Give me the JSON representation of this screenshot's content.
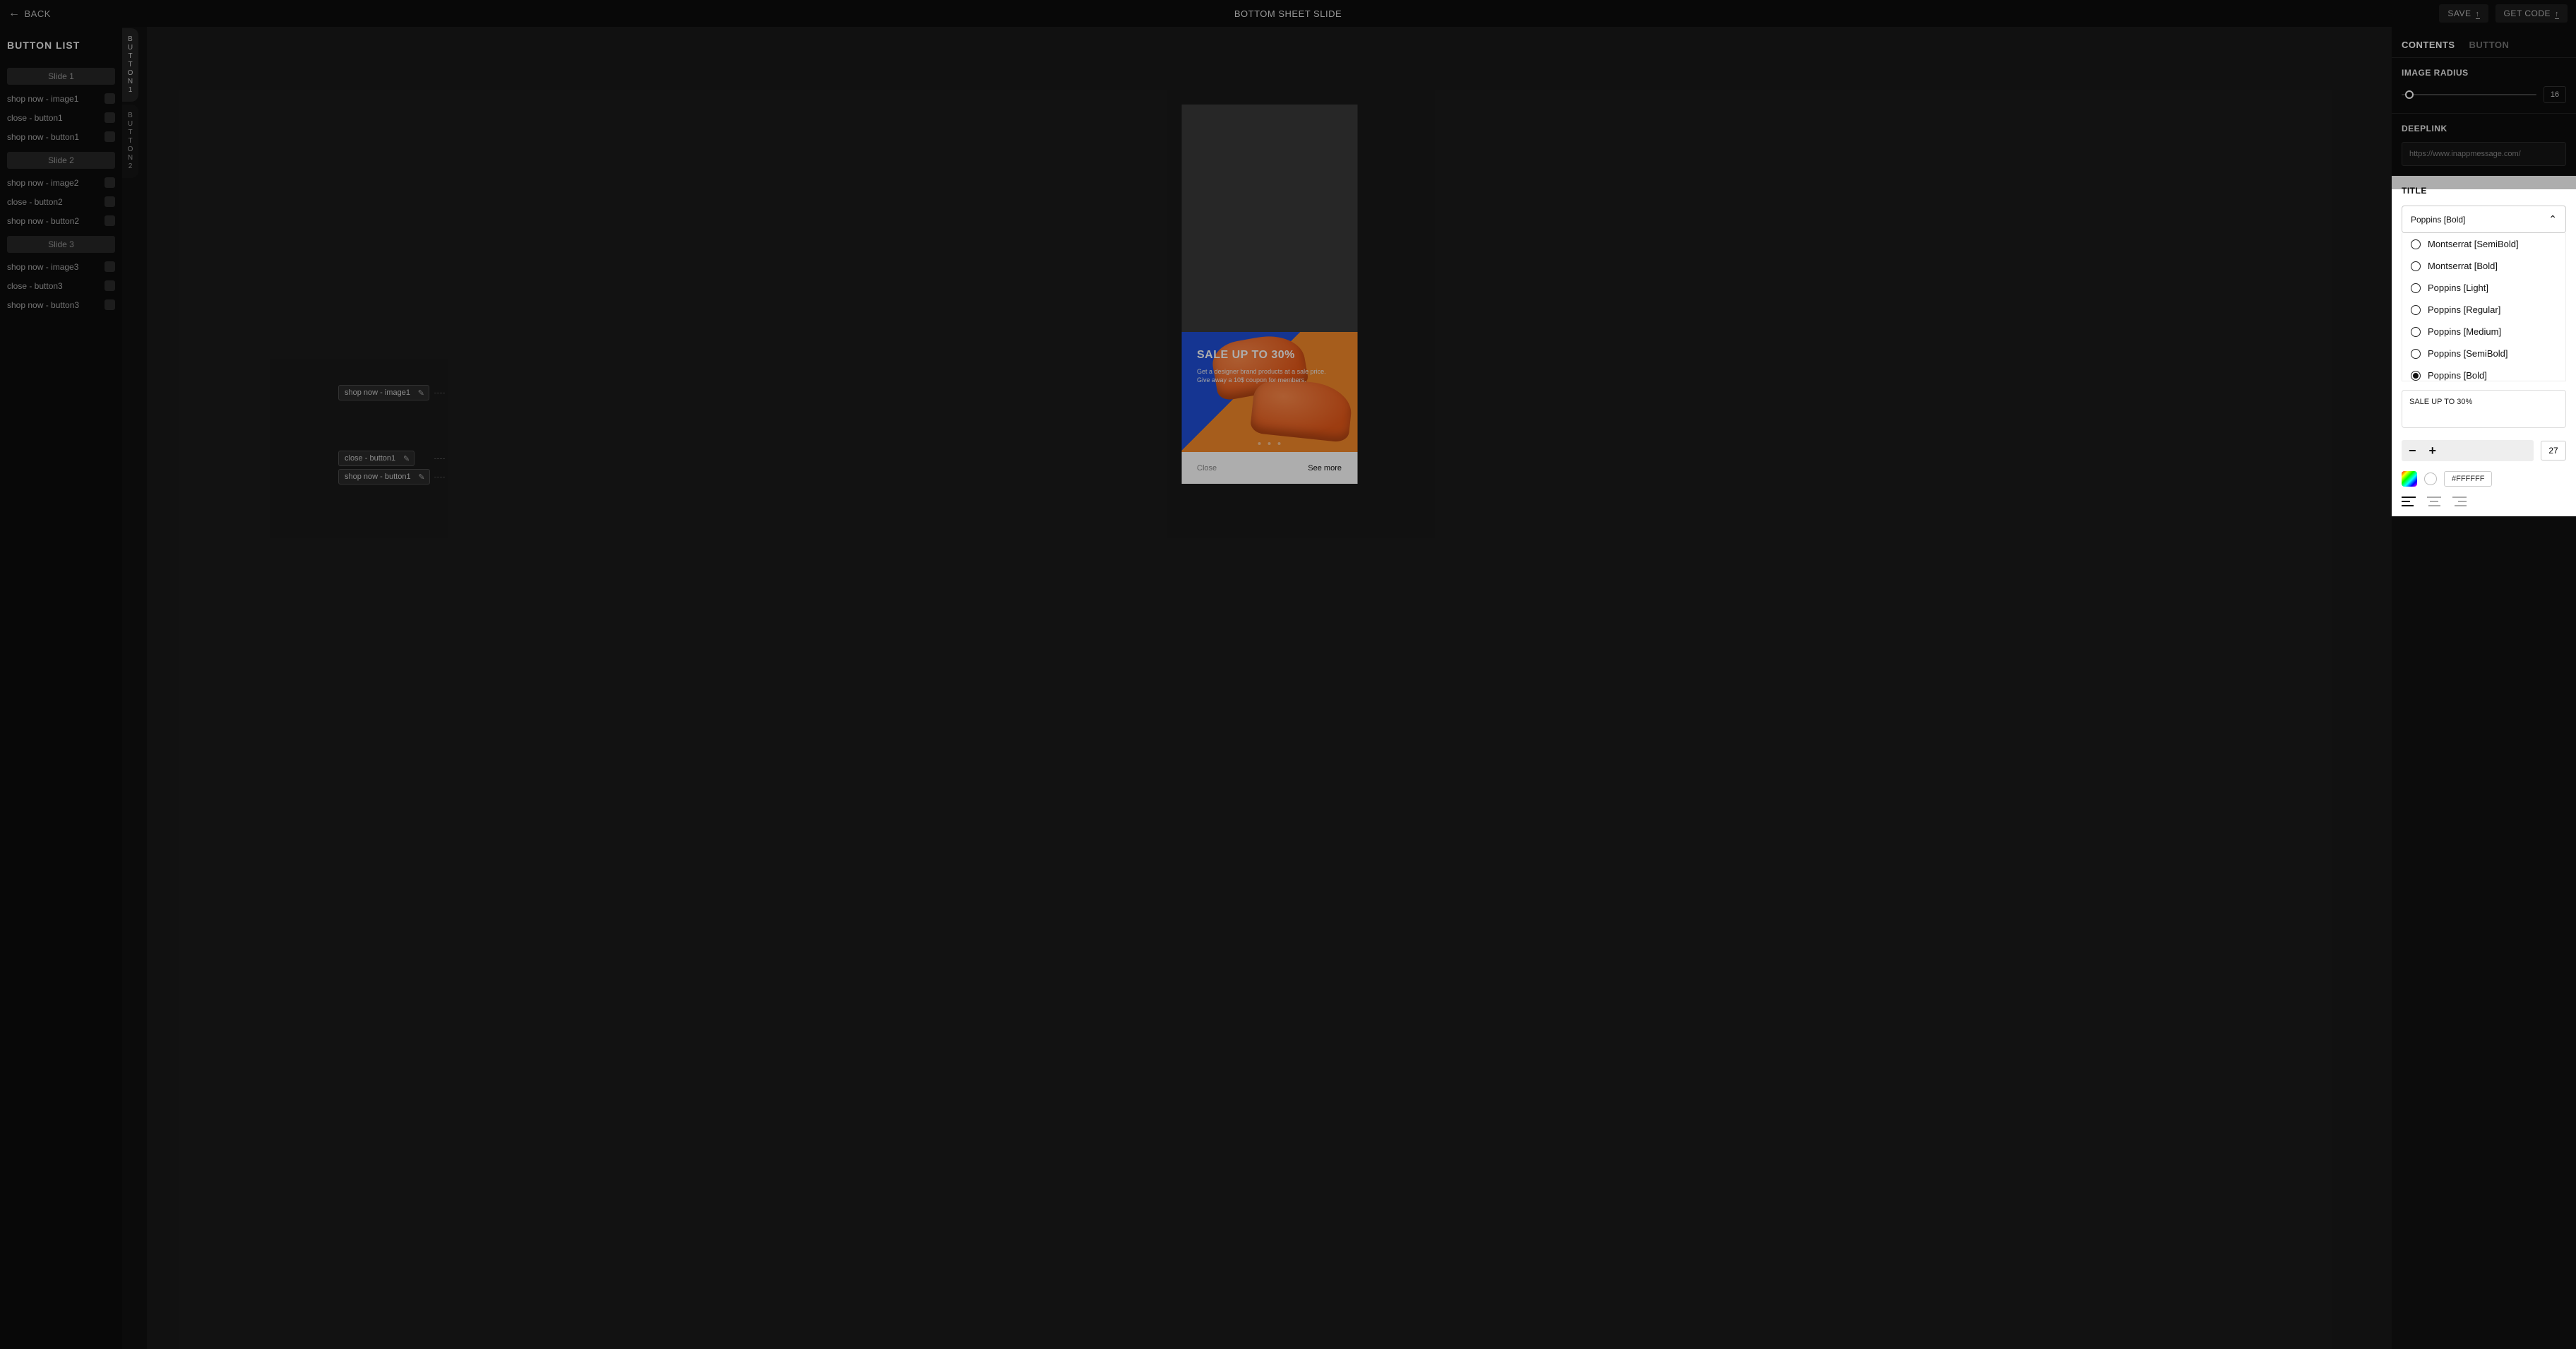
{
  "header": {
    "back": "BACK",
    "title": "BOTTOM SHEET SLIDE",
    "save": "SAVE",
    "getcode": "GET CODE"
  },
  "left": {
    "heading": "BUTTON LIST",
    "slides": [
      {
        "label": "Slide 1",
        "items": [
          "shop now - image1",
          "close - button1",
          "shop now - button1"
        ]
      },
      {
        "label": "Slide 2",
        "items": [
          "shop now - image2",
          "close - button2",
          "shop now - button2"
        ]
      },
      {
        "label": "Slide 3",
        "items": [
          "shop now - image3",
          "close - button3",
          "shop now - button3"
        ]
      }
    ]
  },
  "vtabs": [
    "BUTTON1",
    "BUTTON2"
  ],
  "canvas": {
    "tags": [
      "shop now - image1",
      "close - button1",
      "shop now - button1"
    ],
    "preview": {
      "title": "SALE UP TO 30%",
      "sub1": "Get a designer brand products at a sale price.",
      "sub2": "Give away a 10$ coupon for members.",
      "close": "Close",
      "more": "See more"
    }
  },
  "right": {
    "tabs": {
      "contents": "CONTENTS",
      "button": "BUTTON"
    },
    "imageRadius": {
      "label": "IMAGE RADIUS",
      "value": "16"
    },
    "deeplink": {
      "label": "DEEPLINK",
      "value": "https://www.inappmessage.com/"
    },
    "title": {
      "label": "TITLE",
      "selectedFont": "Poppins [Bold]",
      "fonts": [
        "Montserrat [SemiBold]",
        "Montserrat [Bold]",
        "Poppins [Light]",
        "Poppins [Regular]",
        "Poppins [Medium]",
        "Poppins [SemiBold]",
        "Poppins [Bold]"
      ],
      "text": "SALE UP TO 30%",
      "size": "27",
      "color": "#FFFFFF"
    }
  }
}
